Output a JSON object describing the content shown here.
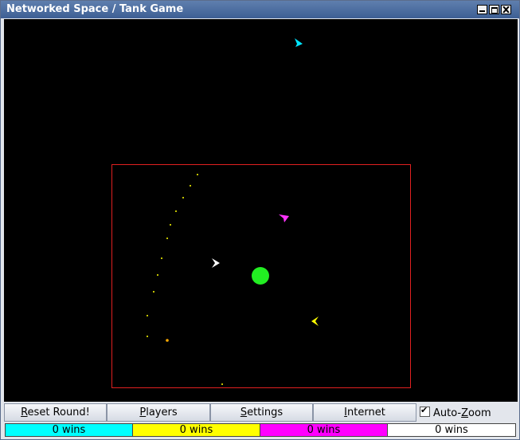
{
  "window": {
    "title": "Networked Space / Tank Game",
    "controls": [
      "minimize-icon",
      "maximize-icon",
      "close-icon"
    ]
  },
  "game": {
    "background": "#000000",
    "arena_border_color": "#ff2020",
    "planet_color": "#22ee22",
    "ships": [
      {
        "player": "cyan",
        "color": "#00e5ff"
      },
      {
        "player": "magenta",
        "color": "#ff33ff"
      },
      {
        "player": "white",
        "color": "#ffffff"
      },
      {
        "player": "yellow",
        "color": "#ffff00"
      }
    ],
    "bullet_color": "#ffff00"
  },
  "toolbar": {
    "reset": {
      "mnemonic": "R",
      "rest": "eset Round!"
    },
    "players": {
      "mnemonic": "P",
      "rest": "layers"
    },
    "settings": {
      "mnemonic": "S",
      "rest": "ettings"
    },
    "internet": {
      "mnemonic": "I",
      "rest": "nternet"
    },
    "autozoom": {
      "pre": "Auto-",
      "mnemonic": "Z",
      "rest": "oom",
      "checked": true
    }
  },
  "scores": [
    {
      "label": "0 wins",
      "color": "#00ffff"
    },
    {
      "label": "0 wins",
      "color": "#ffff00"
    },
    {
      "label": "0 wins",
      "color": "#ff00ff"
    },
    {
      "label": "0 wins",
      "color": "#ffffff"
    }
  ]
}
